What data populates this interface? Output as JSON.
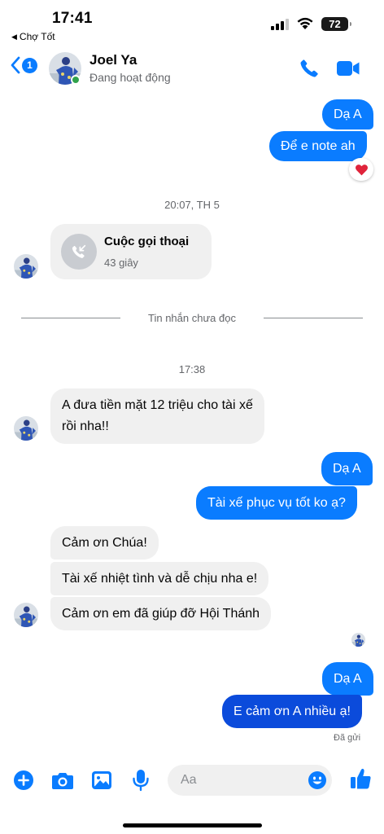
{
  "status_bar": {
    "time": "17:41",
    "back_app": "Chợ Tốt",
    "battery": "72"
  },
  "header": {
    "back_badge": "1",
    "contact_name": "Joel Ya",
    "contact_status": "Đang hoạt động"
  },
  "messages": {
    "m1": "Dạ A",
    "m2": "Để e note ah",
    "time_1": "20:07, TH 5",
    "call_title": "Cuộc gọi thoại",
    "call_duration": "43 giây",
    "unread_divider": "Tin nhắn chưa đọc",
    "time_2": "17:38",
    "m3_line1": "A đưa tiền mặt 12 triệu cho tài xế",
    "m3_line2": "rồi nha!!",
    "m4": "Dạ A",
    "m5": "Tài xế phục vụ tốt ko ạ?",
    "m6": "Cảm ơn Chúa!",
    "m7": "Tài xế nhiệt tình và dễ chịu nha e!",
    "m8": "Cảm ơn em đã giúp đỡ Hội Thánh",
    "m9": "Dạ A",
    "m10": "E cảm ơn A nhiều ạ!",
    "sent_status": "Đã gửi"
  },
  "composer": {
    "placeholder": "Aa"
  },
  "colors": {
    "accent": "#0a7cff",
    "outgoing_bubble": "#0a7cff",
    "outgoing_bubble_latest": "#0b4bdb",
    "incoming_bubble": "#f0f0f0",
    "online": "#31a24c"
  },
  "icons": [
    "back-chevron-icon",
    "phone-icon",
    "video-camera-icon",
    "heart-reaction-icon",
    "missed-call-icon",
    "plus-icon",
    "camera-icon",
    "gallery-icon",
    "microphone-icon",
    "emoji-icon",
    "thumbs-up-icon"
  ]
}
